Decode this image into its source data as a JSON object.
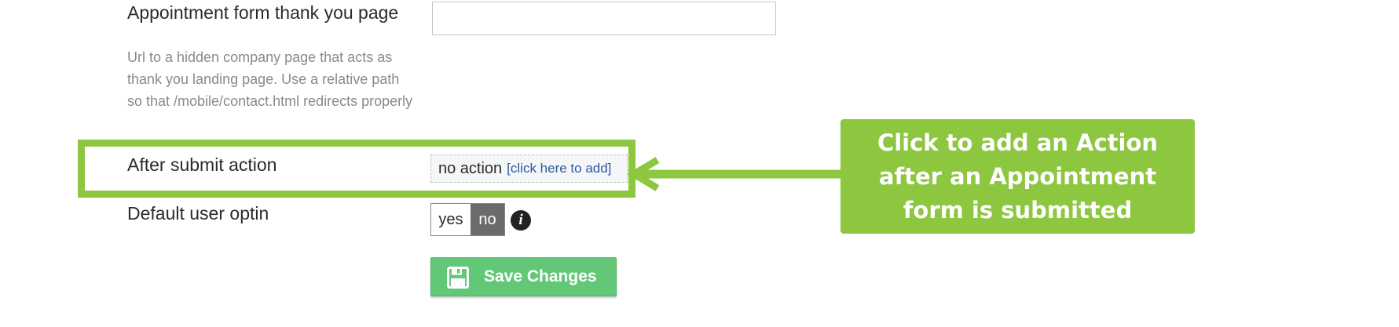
{
  "thank_you": {
    "label": "Appointment form thank you page",
    "help": "Url to a hidden company page that acts as thank you landing page. Use a relative path so that /mobile/contact.html redirects properly",
    "value": ""
  },
  "after_submit": {
    "label": "After submit action",
    "value": "no action",
    "link": "[click here to add]"
  },
  "optin": {
    "label": "Default user optin",
    "yes": "yes",
    "no": "no",
    "selected": "no",
    "info_icon": "info-icon"
  },
  "save": {
    "label": "Save Changes",
    "icon": "floppy-disk-icon"
  },
  "callout": {
    "line1": "Click to add an Action",
    "line2": "after an Appointment",
    "line3": "form is submitted"
  },
  "colors": {
    "accent_green": "#8dc63f",
    "save_green": "#62c878",
    "link_blue": "#2a5aa5",
    "toggle_selected": "#6b6b6b"
  }
}
